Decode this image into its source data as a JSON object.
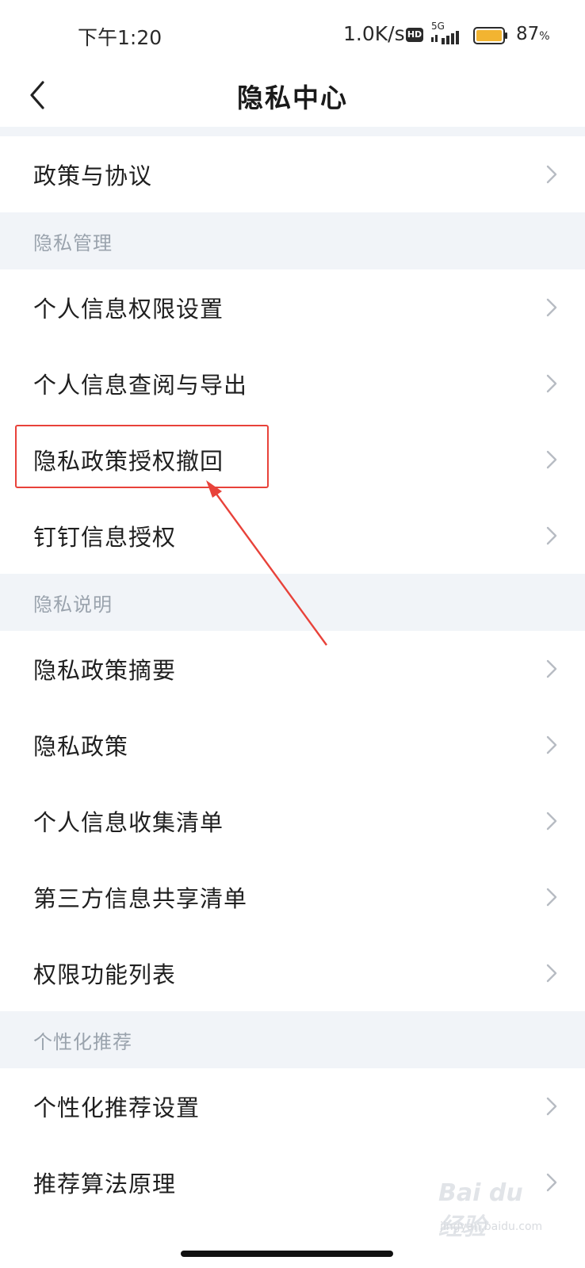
{
  "status_bar": {
    "time": "下午1:20",
    "net_speed": "1.0K/s",
    "hd_label": "HD",
    "network_type": "5G",
    "battery_percent": "87",
    "battery_unit": "%"
  },
  "header": {
    "title": "隐私中心"
  },
  "list": {
    "policy": {
      "label": "政策与协议"
    },
    "privacy_management": {
      "header": "隐私管理",
      "items": [
        {
          "label": "个人信息权限设置"
        },
        {
          "label": "个人信息查阅与导出"
        },
        {
          "label": "隐私政策授权撤回"
        },
        {
          "label": "钉钉信息授权"
        }
      ]
    },
    "privacy_explanation": {
      "header": "隐私说明",
      "items": [
        {
          "label": "隐私政策摘要"
        },
        {
          "label": "隐私政策"
        },
        {
          "label": "个人信息收集清单"
        },
        {
          "label": "第三方信息共享清单"
        },
        {
          "label": "权限功能列表"
        }
      ]
    },
    "personalized": {
      "header": "个性化推荐",
      "items": [
        {
          "label": "个性化推荐设置"
        },
        {
          "label": "推荐算法原理"
        }
      ]
    }
  },
  "watermark": {
    "text": "Bai du 经验",
    "sub": "jingyan.baidu.com"
  },
  "colors": {
    "accent_annotation": "#e8423a",
    "section_bg": "#f1f4f8",
    "section_text": "#9aa3ad",
    "battery_fill": "#f2b431"
  }
}
